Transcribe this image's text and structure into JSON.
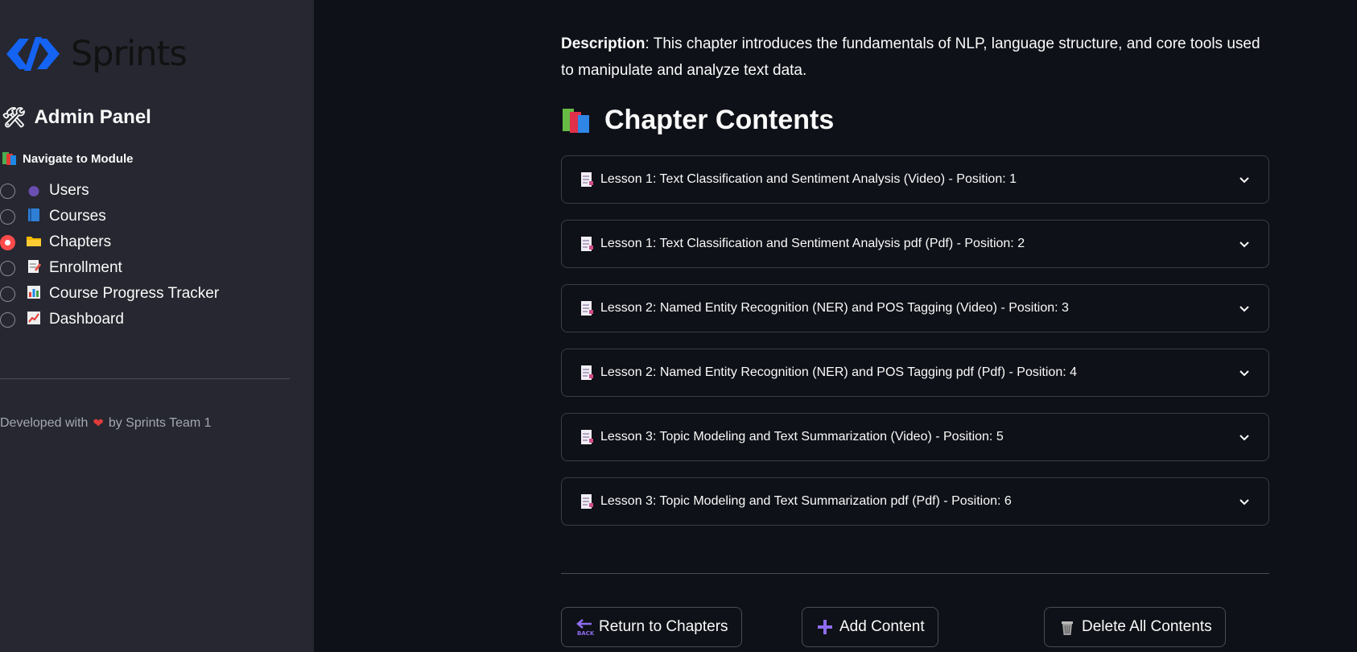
{
  "brand": {
    "name": "Sprints"
  },
  "sidebar": {
    "title": "Admin Panel",
    "title_icon": "tools-icon",
    "nav_heading": "Navigate to Module",
    "nav_heading_icon": "books-icon",
    "items": [
      {
        "label": "Users",
        "icon": "user-icon",
        "selected": false
      },
      {
        "label": "Courses",
        "icon": "book-icon",
        "selected": false
      },
      {
        "label": "Chapters",
        "icon": "folder-icon",
        "selected": true
      },
      {
        "label": "Enrollment",
        "icon": "memo-icon",
        "selected": false
      },
      {
        "label": "Course Progress Tracker",
        "icon": "bar-chart-icon",
        "selected": false
      },
      {
        "label": "Dashboard",
        "icon": "line-chart-icon",
        "selected": false
      }
    ],
    "footer": {
      "prefix": "Developed with",
      "suffix": "by Sprints Team 1"
    }
  },
  "main": {
    "description_label": "Description",
    "description_text": ": This chapter introduces the fundamentals of NLP, language structure, and core tools used to manipulate and analyze text data.",
    "section_title": "Chapter Contents",
    "contents": [
      "Lesson 1: Text Classification and Sentiment Analysis (Video) - Position: 1",
      "Lesson 1: Text Classification and Sentiment Analysis pdf (Pdf) - Position: 2",
      "Lesson 2: Named Entity Recognition (NER) and POS Tagging (Video) - Position: 3",
      "Lesson 2: Named Entity Recognition (NER) and POS Tagging pdf (Pdf) - Position: 4",
      "Lesson 3: Topic Modeling and Text Summarization (Video) - Position: 5",
      "Lesson 3: Topic Modeling and Text Summarization pdf (Pdf) - Position: 6"
    ],
    "buttons": {
      "return": "Return to Chapters",
      "add": "Add Content",
      "delete": "Delete All Contents"
    }
  },
  "colors": {
    "accent": "#ff4b4b",
    "background": "#0e1117",
    "sidebar": "#262730",
    "logo_blue": "#1463f3"
  }
}
